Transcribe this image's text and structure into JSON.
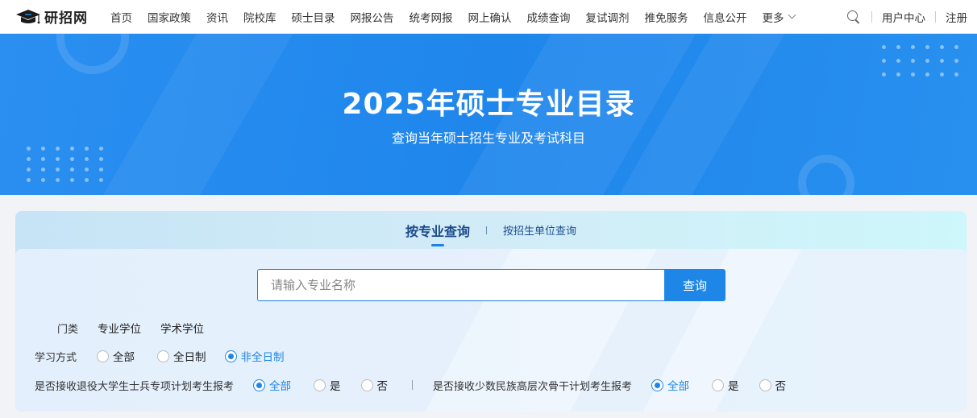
{
  "header": {
    "logo_text": "研招网",
    "nav_items": [
      "首页",
      "国家政策",
      "资讯",
      "院校库",
      "硕士目录",
      "网报公告",
      "统考网报",
      "网上确认",
      "成绩查询",
      "复试调剂",
      "推免服务",
      "信息公开"
    ],
    "more_label": "更多",
    "user_center": "用户中心",
    "register": "注册"
  },
  "banner": {
    "title": "2025年硕士专业目录",
    "subtitle": "查询当年硕士招生专业及考试科目"
  },
  "query": {
    "tab_active": "按专业查询",
    "tab_other": "按招生单位查询",
    "search_placeholder": "请输入专业名称",
    "search_button": "查询",
    "category_label": "门类",
    "category_items": [
      "专业学位",
      "学术学位"
    ],
    "study_mode_label": "学习方式",
    "study_mode_options": [
      "全部",
      "全日制",
      "非全日制"
    ],
    "study_mode_selected": "非全日制",
    "veteran_label": "是否接收退役大学生士兵专项计划考生报考",
    "veteran_options": [
      "全部",
      "是",
      "否"
    ],
    "veteran_selected": "全部",
    "minority_label": "是否接收少数民族高层次骨干计划考生报考",
    "minority_options": [
      "全部",
      "是",
      "否"
    ],
    "minority_selected": "全部"
  },
  "colors": {
    "accent": "#1e86e6",
    "banner": "#1f86ec",
    "tab_text": "#1b4a8a"
  }
}
